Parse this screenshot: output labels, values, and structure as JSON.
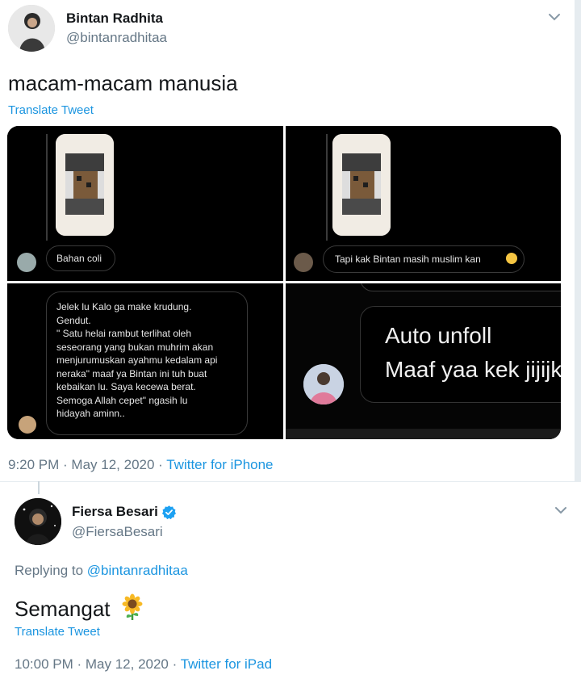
{
  "tweet1": {
    "name": "Bintan Radhita",
    "handle": "@bintanradhitaa",
    "text": "macam-macam manusia",
    "translate": "Translate Tweet",
    "time": "9:20 PM · May 12, 2020 · ",
    "source": "Twitter for iPhone",
    "media": {
      "panel1_msg": "Bahan coli",
      "panel2_msg": "Tapi kak Bintan masih muslim kan",
      "panel3_lines": [
        "Jelek  lu Kalo ga make krudung.",
        "Gendut.",
        "\" Satu helai rambut terlihat oleh",
        "seseorang yang bukan muhrim akan",
        "menjurumuskan ayahmu kedalam api",
        "neraka\" maaf ya Bintan ini tuh buat",
        "kebaikan lu. Saya kecewa berat.",
        "Semoga Allah cepet\" ngasih lu",
        "hidayah aminn.."
      ],
      "panel4_line1": "Auto unfoll",
      "panel4_line2": "Maaf yaa kek jijijk"
    }
  },
  "tweet2": {
    "name": "Fiersa Besari",
    "handle": "@FiersaBesari",
    "replying_prefix": "Replying to ",
    "replying_to": "@bintanradhitaa",
    "text": "Semangat",
    "emoji": "sunflower",
    "translate": "Translate Tweet",
    "time": "10:00 PM · May 12, 2020 · ",
    "source": "Twitter for iPad"
  },
  "colors": {
    "link": "#1b95e0",
    "muted": "#657786",
    "text": "#14171a",
    "verified": "#1da1f2"
  }
}
